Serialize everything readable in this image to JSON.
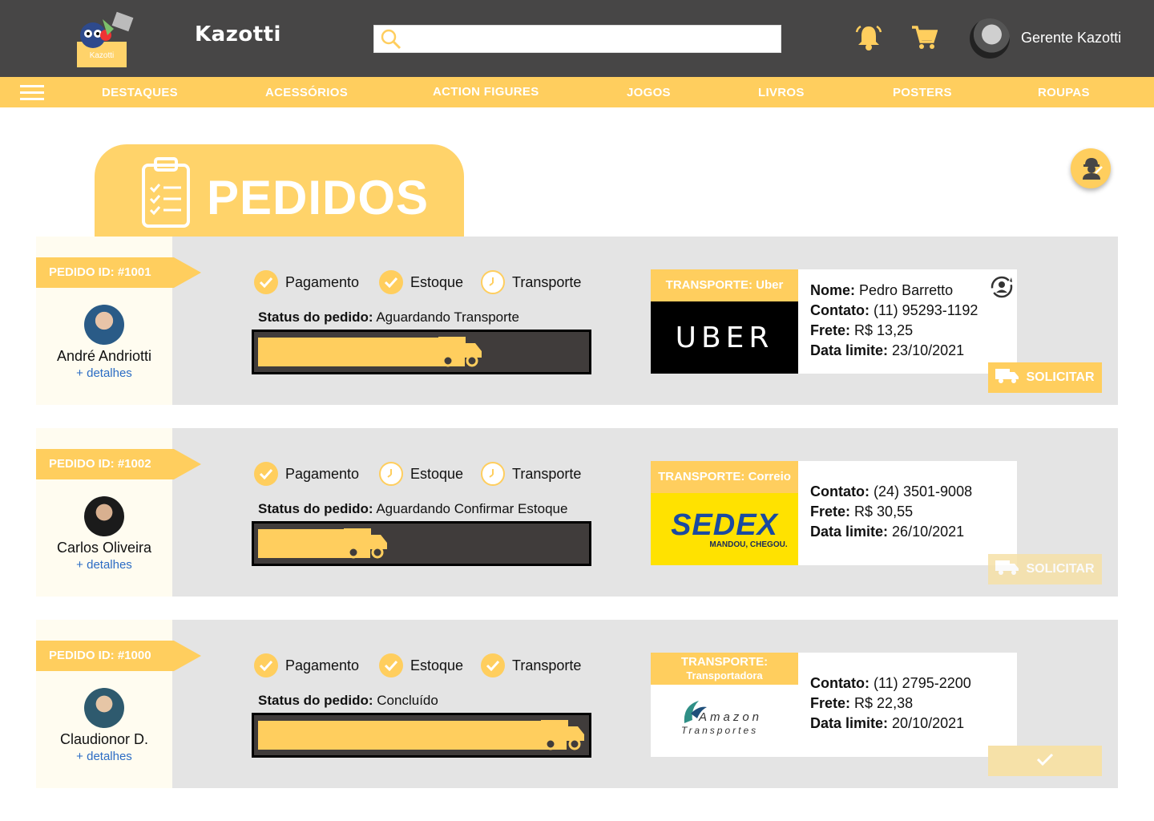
{
  "header": {
    "brand": "Kazotti",
    "logo_label": "Kazotti",
    "search_placeholder": "",
    "user_name": "Gerente Kazotti"
  },
  "nav": {
    "items": [
      "DESTAQUES",
      "ACESSÓRIOS",
      "ACTION FIGURES",
      "JOGOS",
      "LIVROS",
      "POSTERS",
      "ROUPAS"
    ]
  },
  "page": {
    "title": "PEDIDOS"
  },
  "colors": {
    "accent": "#FFCE5E",
    "topbar": "#474646",
    "card": "#E4E4E4",
    "progress_bg": "#403C3B",
    "link": "#2b6cc4"
  },
  "orders": [
    {
      "id_label": "PEDIDO ID: #1001",
      "customer": "André Andriotti",
      "details_link": "+ detalhes",
      "steps": [
        {
          "label": "Pagamento",
          "state": "done"
        },
        {
          "label": "Estoque",
          "state": "done"
        },
        {
          "label": "Transporte",
          "state": "pending"
        }
      ],
      "status_label": "Status do pedido:",
      "status_value": "Aguardando Transporte",
      "progress": 0.62,
      "carrier_head": "TRANSPORTE: Uber",
      "carrier_logo": "UBER",
      "info": [
        {
          "k": "Nome:",
          "v": "Pedro Barretto"
        },
        {
          "k": "Contato:",
          "v": "(11) 95293-1192"
        },
        {
          "k": "Frete:",
          "v": "R$ 13,25"
        },
        {
          "k": "Data limite:",
          "v": "23/10/2021"
        }
      ],
      "action": "SOLICITAR"
    },
    {
      "id_label": "PEDIDO ID: #1002",
      "customer": "Carlos Oliveira",
      "details_link": "+ detalhes",
      "steps": [
        {
          "label": "Pagamento",
          "state": "done"
        },
        {
          "label": "Estoque",
          "state": "pending"
        },
        {
          "label": "Transporte",
          "state": "pending"
        }
      ],
      "status_label": "Status do pedido:",
      "status_value": "Aguardando Confirmar Estoque",
      "progress": 0.34,
      "carrier_head": "TRANSPORTE: Correio",
      "carrier_logo": "SEDEX",
      "carrier_logo_sub": "MANDOU, CHEGOU.",
      "info": [
        {
          "k": "Contato:",
          "v": "(24) 3501-9008"
        },
        {
          "k": "Frete:",
          "v": "R$ 30,55"
        },
        {
          "k": "Data limite:",
          "v": "26/10/2021"
        }
      ],
      "action": "SOLICITAR"
    },
    {
      "id_label": "PEDIDO ID: #1000",
      "customer": "Claudionor D.",
      "details_link": "+ detalhes",
      "steps": [
        {
          "label": "Pagamento",
          "state": "done"
        },
        {
          "label": "Estoque",
          "state": "done"
        },
        {
          "label": "Transporte",
          "state": "done"
        }
      ],
      "status_label": "Status do pedido:",
      "status_value": "Concluído",
      "progress": 1.0,
      "carrier_head": "TRANSPORTE:",
      "carrier_head_sub": "Transportadora",
      "carrier_logo": "Amazon",
      "carrier_logo_sub": "Transportes",
      "info": [
        {
          "k": "Contato:",
          "v": "(11) 2795-2200"
        },
        {
          "k": "Frete:",
          "v": "R$ 22,38"
        },
        {
          "k": "Data limite:",
          "v": "20/10/2021"
        }
      ],
      "action": "check-icon"
    }
  ]
}
